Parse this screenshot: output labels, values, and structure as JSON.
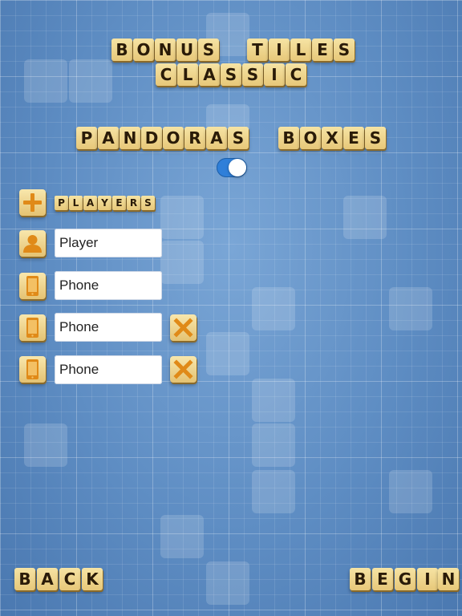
{
  "title": {
    "line1": [
      "B",
      "O",
      "N",
      "U",
      "S",
      " ",
      "T",
      "I",
      "L",
      "E",
      "S"
    ],
    "line2": [
      "C",
      "L",
      "A",
      "S",
      "S",
      "I",
      "C"
    ]
  },
  "mode": {
    "word1": [
      "P",
      "A",
      "N",
      "D",
      "O",
      "R",
      "A",
      "S"
    ],
    "word2": [
      "B",
      "O",
      "X",
      "E",
      "S"
    ],
    "toggle_on": true,
    "toggle_color": "#2f7fd9"
  },
  "players_section": {
    "add_icon": "plus-icon",
    "label": [
      "P",
      "L",
      "A",
      "Y",
      "E",
      "R",
      "S"
    ]
  },
  "players": [
    {
      "type_icon": "person-icon",
      "value": "Player",
      "removable": false
    },
    {
      "type_icon": "phone-icon",
      "value": "Phone",
      "removable": false
    },
    {
      "type_icon": "phone-icon",
      "value": "Phone",
      "removable": true
    },
    {
      "type_icon": "phone-icon",
      "value": "Phone",
      "removable": true
    }
  ],
  "footer": {
    "back": [
      "B",
      "A",
      "C",
      "K"
    ],
    "begin": [
      "B",
      "E",
      "G",
      "I",
      "N"
    ]
  },
  "colors": {
    "tile": "#ecd28a",
    "icon_orange": "#e08a18",
    "background": "#5f8fc4"
  }
}
